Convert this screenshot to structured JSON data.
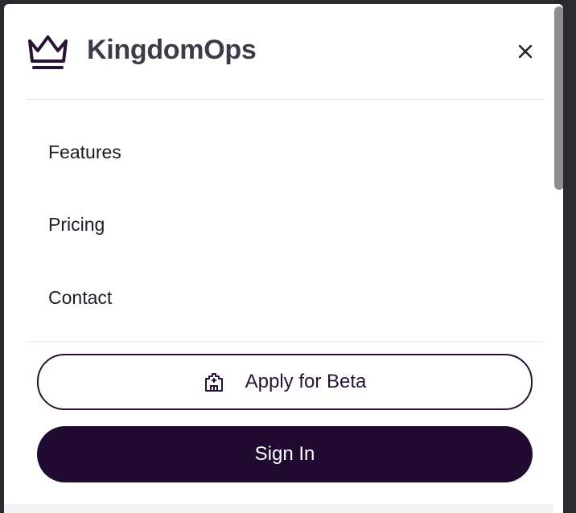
{
  "brand": {
    "name": "KingdomOps",
    "logo_icon": "crown-icon"
  },
  "header": {
    "close_icon": "close-icon"
  },
  "nav": {
    "items": [
      {
        "label": "Features"
      },
      {
        "label": "Pricing"
      },
      {
        "label": "Contact"
      }
    ]
  },
  "actions": {
    "apply_beta": {
      "label": "Apply for Beta",
      "icon": "castle-icon"
    },
    "sign_in": {
      "label": "Sign In"
    }
  },
  "colors": {
    "primary": "#200a30",
    "brand_text": "#3b3b4a",
    "backdrop": "#2a2b2e"
  }
}
